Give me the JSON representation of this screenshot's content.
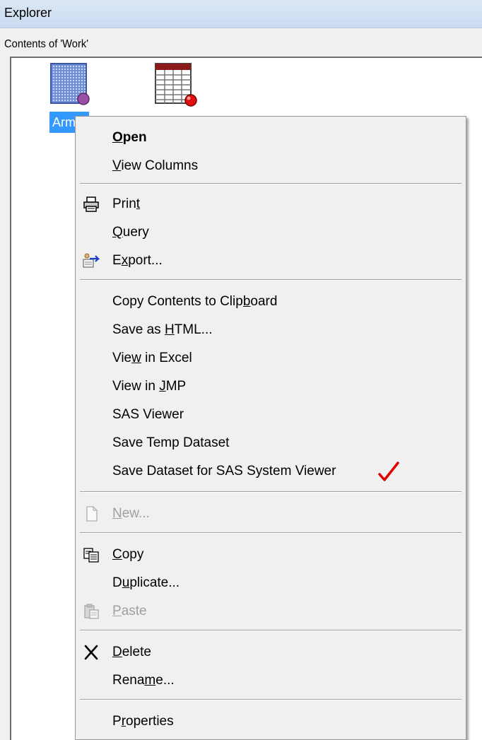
{
  "window": {
    "title": "Explorer"
  },
  "pane": {
    "label": "Contents of 'Work'"
  },
  "files": [
    {
      "label": "Arm",
      "icon": "data-view-icon",
      "selected": true
    },
    {
      "label": "",
      "icon": "data-table-icon",
      "selected": false
    }
  ],
  "context_menu": {
    "groups": [
      [
        {
          "label": "Open",
          "mnemonic": "O",
          "bold": true
        },
        {
          "label": "View Columns",
          "mnemonic": "V"
        }
      ],
      [
        {
          "label": "Print",
          "mnemonic": "t",
          "icon": "printer-icon"
        },
        {
          "label": "Query",
          "mnemonic": "Q"
        },
        {
          "label": "Export...",
          "mnemonic": "x",
          "icon": "export-icon"
        }
      ],
      [
        {
          "label": "Copy Contents to Clipboard",
          "mnemonic": "b"
        },
        {
          "label": "Save as HTML...",
          "mnemonic": "H"
        },
        {
          "label": "View in Excel",
          "mnemonic": "w"
        },
        {
          "label": "View in JMP",
          "mnemonic": "J"
        },
        {
          "label": "SAS Viewer"
        },
        {
          "label": "Save Temp Dataset"
        },
        {
          "label": "Save Dataset for SAS System Viewer",
          "annotation": "red-check-mark"
        }
      ],
      [
        {
          "label": "New...",
          "mnemonic": "N",
          "icon": "new-document-icon",
          "disabled": true
        }
      ],
      [
        {
          "label": "Copy",
          "mnemonic": "C",
          "icon": "copy-icon"
        },
        {
          "label": "Duplicate...",
          "mnemonic": "u"
        },
        {
          "label": "Paste",
          "mnemonic": "P",
          "icon": "paste-icon",
          "disabled": true
        }
      ],
      [
        {
          "label": "Delete",
          "mnemonic": "D",
          "icon": "delete-x-icon"
        },
        {
          "label": "Rename...",
          "mnemonic": "m"
        }
      ],
      [
        {
          "label": "Properties",
          "mnemonic": "r"
        }
      ]
    ]
  },
  "colors": {
    "selection": "#3399ff",
    "menu_background": "#f0f0f0",
    "disabled_text": "#a0a0a0",
    "check_mark": "#e00000"
  }
}
